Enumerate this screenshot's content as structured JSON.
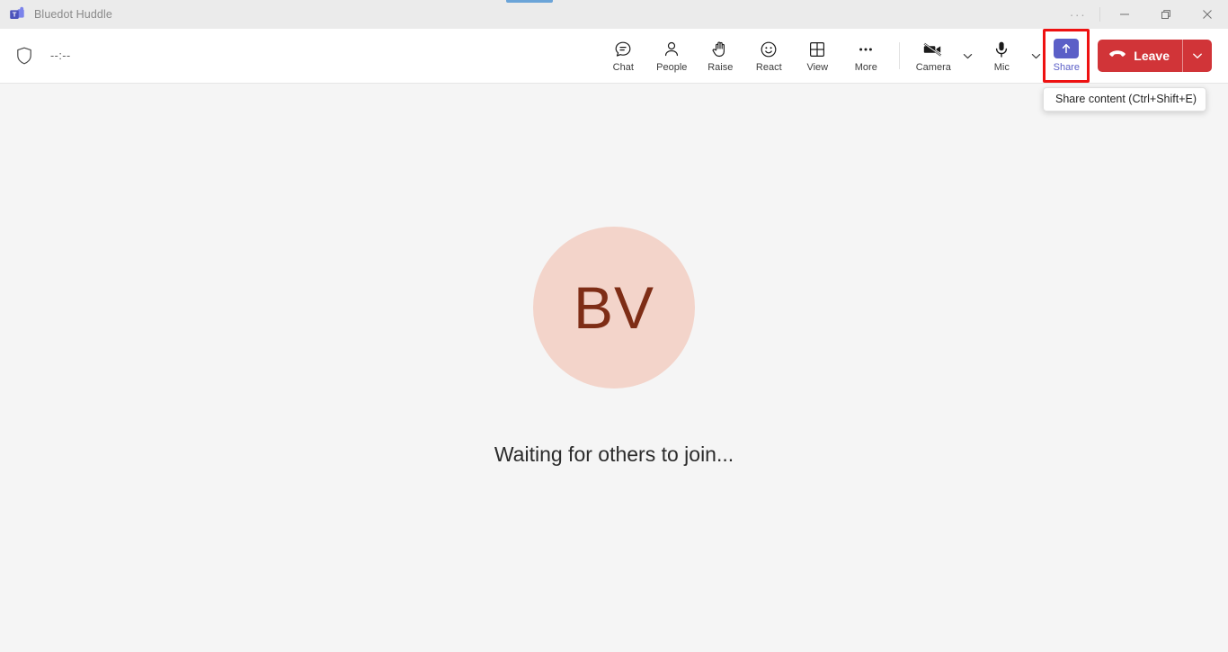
{
  "window": {
    "app_title": "Bluedot Huddle",
    "logo_icon": "microsoft-teams-logo",
    "drag_handle_color": "#6ba4d8",
    "controls": {
      "more_label": "···",
      "minimize_label": "─",
      "restore_label": "❐",
      "close_label": "✕"
    }
  },
  "toolbar": {
    "shield_icon": "shield-icon",
    "timer": "--:--",
    "items": [
      {
        "label": "Chat",
        "icon": "chat-bubble-icon"
      },
      {
        "label": "People",
        "icon": "people-icon"
      },
      {
        "label": "Raise",
        "icon": "raise-hand-icon"
      },
      {
        "label": "React",
        "icon": "smiley-react-icon"
      },
      {
        "label": "View",
        "icon": "grid-view-icon"
      },
      {
        "label": "More",
        "icon": "more-ellipsis-icon"
      }
    ],
    "camera": {
      "label": "Camera",
      "icon": "camera-off-icon",
      "muted": true,
      "chevron_icon": "chevron-down-icon"
    },
    "mic": {
      "label": "Mic",
      "icon": "microphone-icon",
      "chevron_icon": "chevron-down-icon"
    },
    "share": {
      "label": "Share",
      "icon": "share-upload-icon",
      "accent_color": "#5b5fc7",
      "highlight_color": "#ee1111",
      "highlighted": true
    },
    "leave": {
      "label": "Leave",
      "icon": "hangup-phone-icon",
      "caret_icon": "chevron-down-icon",
      "color": "#d13438"
    }
  },
  "tooltip": {
    "text": "Share content (Ctrl+Shift+E)"
  },
  "stage": {
    "avatar": {
      "initials": "BV",
      "background_color": "#f3d4ca",
      "text_color": "#7e2d16"
    },
    "status_text": "Waiting for others to join..."
  }
}
